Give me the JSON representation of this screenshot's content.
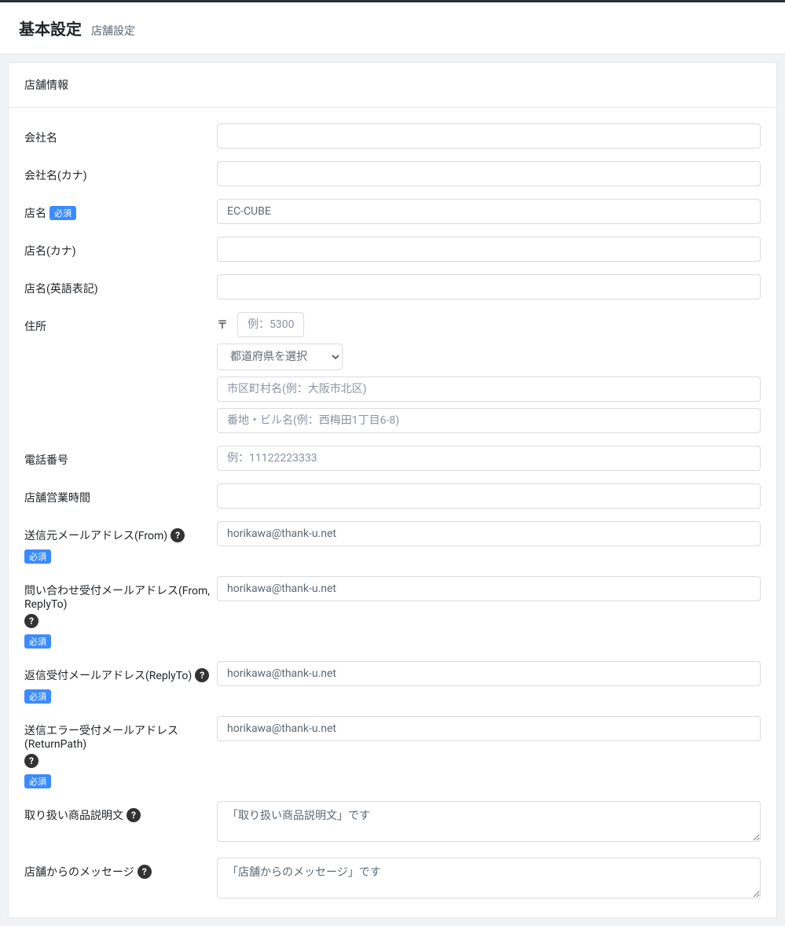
{
  "header": {
    "title": "基本設定",
    "subtitle": "店舗設定"
  },
  "section_title": "店舗情報",
  "labels": {
    "company_name": "会社名",
    "company_name_kana": "会社名(カナ)",
    "shop_name": "店名",
    "shop_name_kana": "店名(カナ)",
    "shop_name_en": "店名(英語表記)",
    "address": "住所",
    "phone": "電話番号",
    "business_hours": "店舗営業時間",
    "email_from": "送信元メールアドレス(From)",
    "email_inquiry": "問い合わせ受付メールアドレス(From, ReplyTo)",
    "email_reply": "返信受付メールアドレス(ReplyTo)",
    "email_return": "送信エラー受付メールアドレス(ReturnPath)",
    "good_traded": "取り扱い商品説明文",
    "shop_message": "店舗からのメッセージ"
  },
  "required_badge": "必須",
  "postal_symbol": "〒",
  "placeholders": {
    "postal": "例：5300",
    "pref_select": "都道府県を選択",
    "addr1": "市区町村名(例：大阪市北区)",
    "addr2": "番地・ビル名(例：西梅田1丁目6-8)",
    "phone": "例：11122223333"
  },
  "values": {
    "company_name": "",
    "company_name_kana": "",
    "shop_name": "EC-CUBE",
    "shop_name_kana": "",
    "shop_name_en": "",
    "postal": "",
    "addr1": "",
    "addr2": "",
    "phone": "",
    "business_hours": "",
    "email_from": "horikawa@thank-u.net",
    "email_inquiry": "horikawa@thank-u.net",
    "email_reply": "horikawa@thank-u.net",
    "email_return": "horikawa@thank-u.net",
    "good_traded": "「取り扱い商品説明文」です",
    "shop_message": "「店舗からのメッセージ」です"
  }
}
